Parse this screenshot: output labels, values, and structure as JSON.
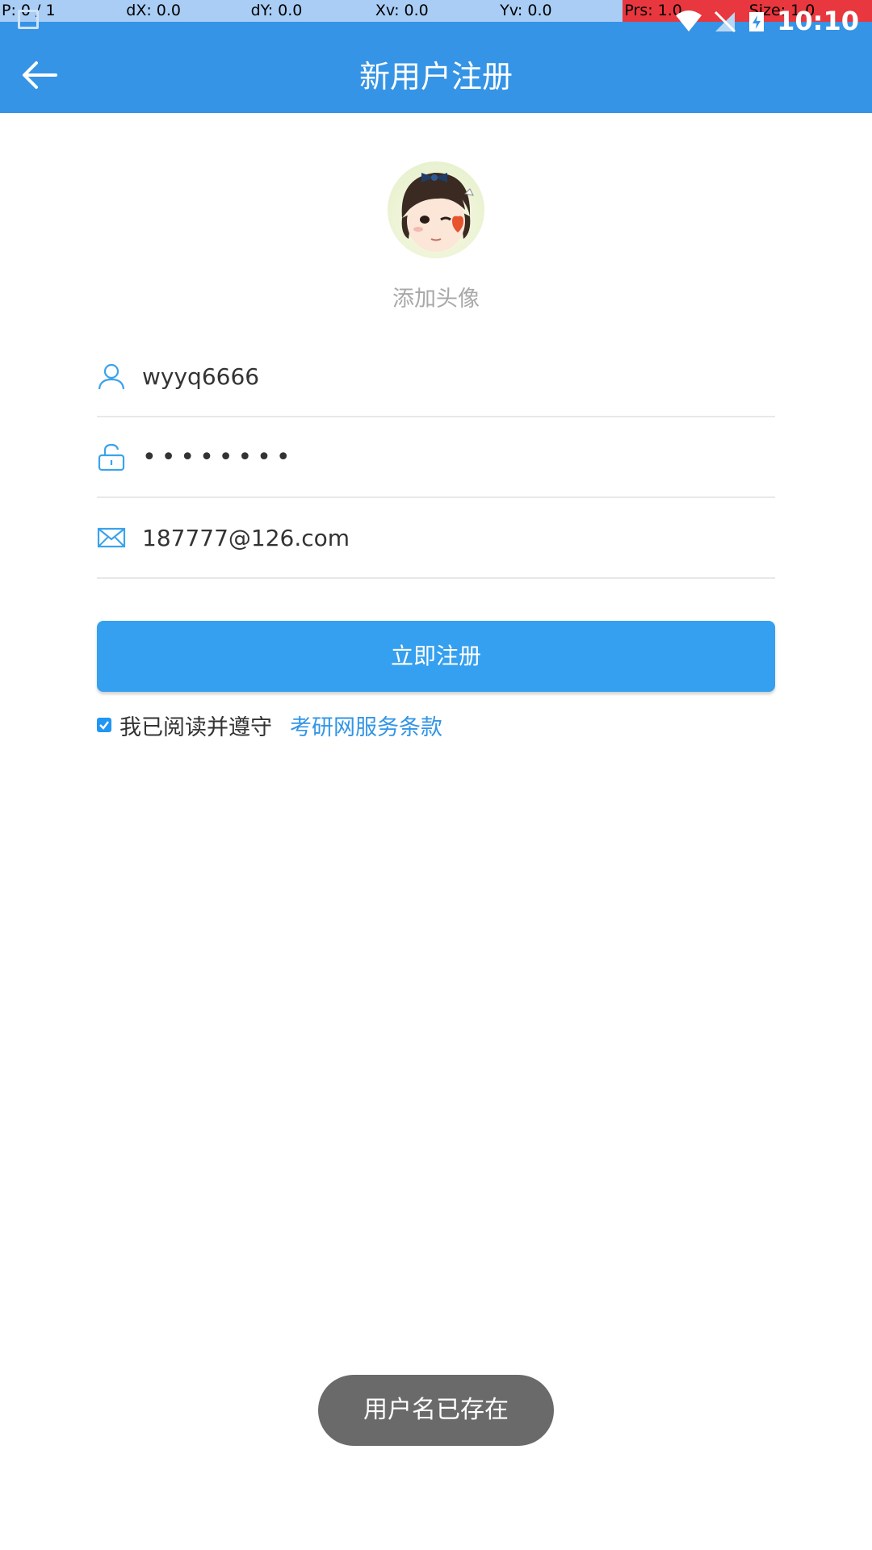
{
  "debug_overlay": {
    "pointer": "P: 0 / 1",
    "dx": "dX: 0.0",
    "dy": "dY: 0.0",
    "xv": "Xv: 0.0",
    "yv": "Yv: 0.0",
    "prs": "Prs: 1.0",
    "size": "Size: 1.0"
  },
  "status_bar": {
    "time": "10:10",
    "icons": [
      "image-icon",
      "wifi-icon",
      "signal-off-icon",
      "battery-icon"
    ]
  },
  "header": {
    "title": "新用户注册",
    "back_icon": "arrow-left-icon"
  },
  "avatar": {
    "label": "添加头像"
  },
  "form": {
    "username": {
      "value": "wyyq6666",
      "icon": "user-icon"
    },
    "password": {
      "value": "••••••••",
      "icon": "lock-icon"
    },
    "email": {
      "value": "187777@126.com",
      "icon": "mail-icon"
    }
  },
  "register_button": {
    "label": "立即注册"
  },
  "agreement": {
    "checked": true,
    "text": "我已阅读并遵守",
    "link": "考研网服务条款"
  },
  "toast": {
    "message": "用户名已存在"
  },
  "colors": {
    "primary": "#3594e5",
    "button": "#35a0ef",
    "link": "#3295e6",
    "toast_bg": "#6a6a6a"
  }
}
